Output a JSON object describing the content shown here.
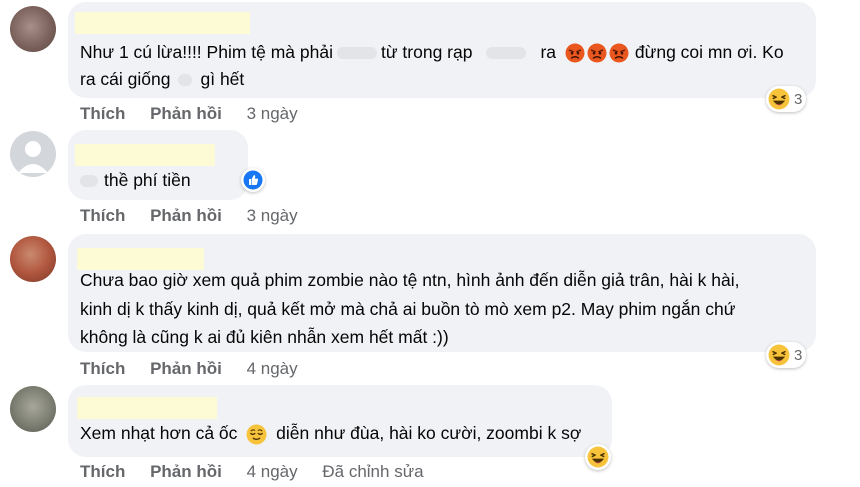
{
  "comments": [
    {
      "text_part1": "Như 1 cú lừa!!!! Phim tệ mà phải",
      "text_part2": "từ trong rạp",
      "text_part3": "ra",
      "text_part4": "đừng coi mn ơi. Ko",
      "line2_part1": "ra cái giống",
      "line2_part2": "gì hết",
      "like": "Thích",
      "reply": "Phản hồi",
      "time": "3 ngày",
      "reaction_count": "3",
      "reaction_icon": "laugh-emoji"
    },
    {
      "text": "thề phí tiền",
      "like": "Thích",
      "reply": "Phản hồi",
      "time": "3 ngày",
      "reaction_icon": "like-emoji"
    },
    {
      "line1": "Chưa bao giờ xem quả phim zombie nào tệ ntn, hình ảnh đến diễn giả trân, hài k hài,",
      "line2": "kinh dị k thấy kinh dị, quả kết mở mà chả ai buồn tò mò xem p2. May phim ngắn chứ",
      "line3": "không là cũng k ai đủ kiên nhẫn xem hết mất :))",
      "like": "Thích",
      "reply": "Phản hồi",
      "time": "4 ngày",
      "reaction_count": "3",
      "reaction_icon": "laugh-emoji"
    },
    {
      "text_part1": "Xem nhạt hơn cả ốc",
      "text_part2": "diễn như đùa, hài ko cười, zoombi k sợ",
      "like": "Thích",
      "reply": "Phản hồi",
      "time": "4 ngày",
      "edited": "Đã chỉnh sửa",
      "reaction_icon": "laugh-emoji"
    }
  ],
  "colors": {
    "bubble": "#f0f2f5",
    "text": "#050505",
    "meta": "#65676b",
    "name_highlight": "#fdfbd6"
  }
}
